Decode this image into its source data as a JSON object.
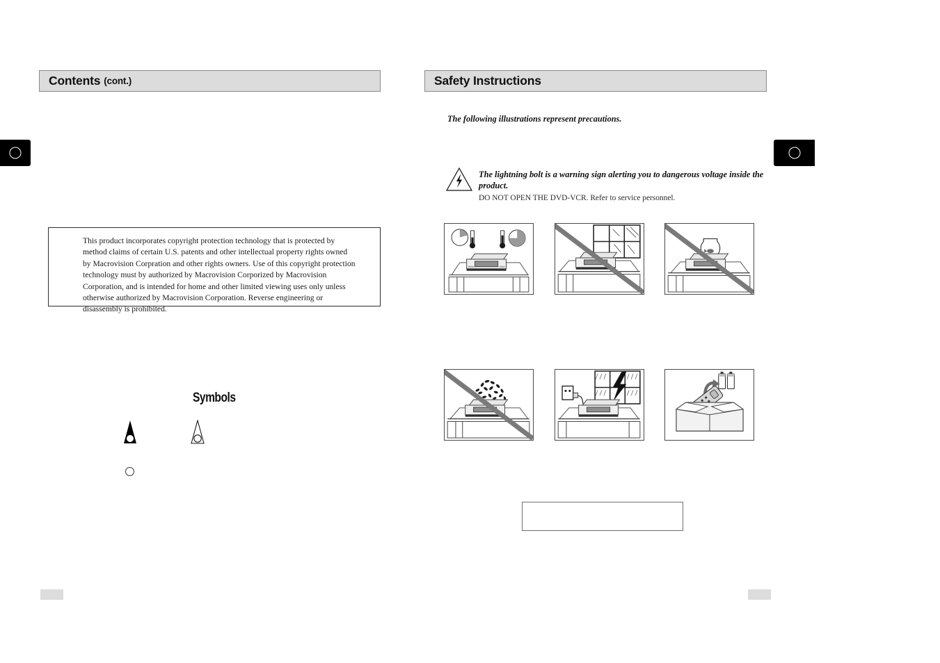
{
  "left_page": {
    "header": {
      "title": "Contents",
      "subtitle": "(cont.)"
    },
    "copyright_notice": "This product incorporates copyright protection technology that is protected by method claims of certain U.S. patents and other intellectual property rights owned by Macrovision Corpration and other rights owners. Use of this copyright protection technology must by authorized by Macrovision Corporized by Macrovision Corporation, and is intended for home and other limited viewing uses only unless otherwise authorized by Macrovision Corporation. Reverse engineering or disassembly is prohibited.",
    "symbols": {
      "title": "Symbols",
      "items": [
        {
          "name": "cone-filled-symbol",
          "style": "filled"
        },
        {
          "name": "cone-outline-symbol",
          "style": "outline"
        },
        {
          "name": "small-circle-symbol",
          "style": "outline"
        }
      ]
    },
    "page_number": ""
  },
  "right_page": {
    "header": {
      "title": "Safety Instructions"
    },
    "intro": "The following illustrations represent precautions.",
    "lightning_warning": {
      "icon": "lightning-bolt-triangle-icon",
      "bold_line": "The lightning bolt is a warning sign alerting you to dangerous voltage inside the product.",
      "plain_line": "DO NOT OPEN THE DVD-VCR. Refer to service personnel."
    },
    "illustrations": [
      {
        "id": "illus-1",
        "name": "temperature-humidity-illustration",
        "prohibited": false
      },
      {
        "id": "illus-2",
        "name": "direct-sunlight-window-illustration",
        "prohibited": true
      },
      {
        "id": "illus-3",
        "name": "fishbowl-on-unit-illustration",
        "prohibited": true
      },
      {
        "id": "illus-4",
        "name": "plant-on-unit-illustration",
        "prohibited": true
      },
      {
        "id": "illus-5",
        "name": "unplug-during-lightning-storm-illustration",
        "prohibited": false
      },
      {
        "id": "illus-6",
        "name": "remote-batteries-storage-box-illustration",
        "prohibited": false
      }
    ],
    "note_box": "",
    "page_number": ""
  },
  "tabs": {
    "left": {
      "name": "page-tab-left",
      "marker": "circle"
    },
    "right": {
      "name": "page-tab-right",
      "marker": "circle"
    }
  },
  "colors": {
    "header_fill": "#dcdcdc",
    "header_border": "#8a8a8a",
    "tab_fill": "#000000",
    "illustration_border": "#4a4a4a",
    "slash_gray": "#7a7a7a"
  }
}
